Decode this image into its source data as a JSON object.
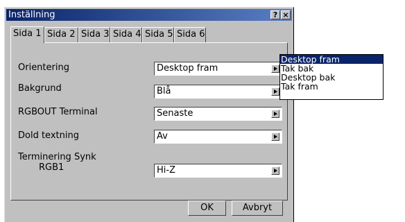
{
  "window": {
    "title": "Inställning",
    "help_label": "?",
    "close_label": "×"
  },
  "tabs": [
    {
      "label": "Sida 1"
    },
    {
      "label": "Sida 2"
    },
    {
      "label": "Sida 3"
    },
    {
      "label": "Sida 4"
    },
    {
      "label": "Sida 5"
    },
    {
      "label": "Sida 6"
    }
  ],
  "settings": {
    "orientation": {
      "label": "Orientering",
      "value": "Desktop fram"
    },
    "background": {
      "label": "Bakgrund",
      "value": "Blå"
    },
    "rgbout": {
      "label": "RGBOUT Terminal",
      "value": "Senaste"
    },
    "captions": {
      "label": "Dold textning",
      "value": "Av"
    },
    "sync_termination": {
      "label": "Terminering Synk",
      "sublabel": "RGB1",
      "value": "Hi-Z"
    }
  },
  "dropdown": {
    "options": [
      "Desktop fram",
      "Tak bak",
      "Desktop bak",
      "Tak fram"
    ],
    "selected": "Desktop fram"
  },
  "buttons": {
    "ok": "OK",
    "cancel": "Avbryt"
  },
  "colors": {
    "titlebar": "#0a246a",
    "face": "#c0c0c0",
    "selection": "#0a246a"
  }
}
